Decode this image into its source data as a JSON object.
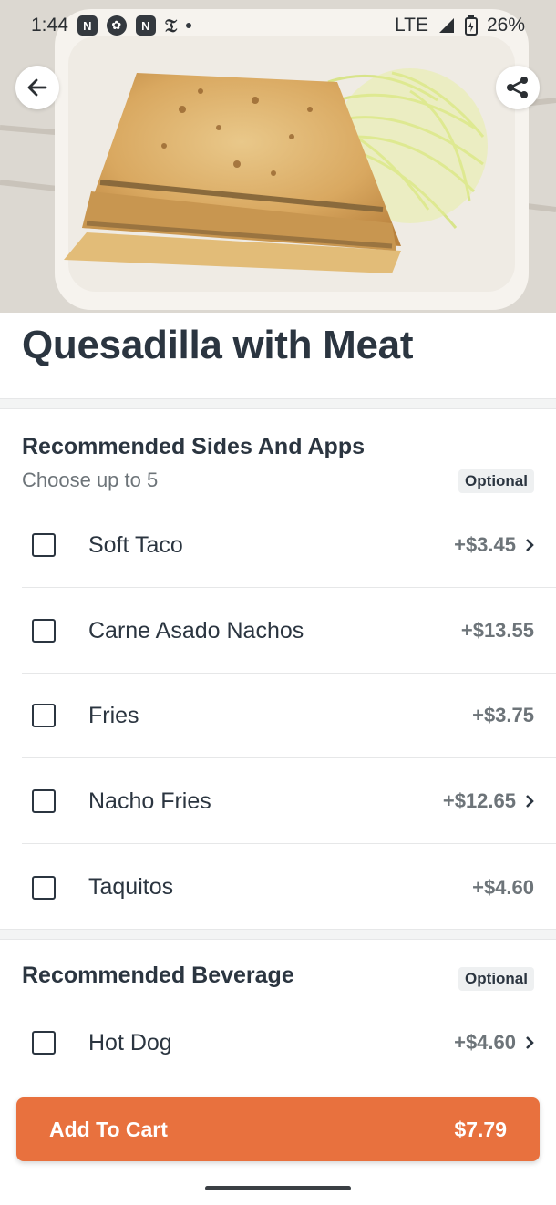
{
  "status_bar": {
    "time": "1:44",
    "network": "LTE",
    "battery": "26%",
    "icons": [
      "news-app-icon",
      "settings-app-icon",
      "news-app-icon",
      "nyt-icon"
    ]
  },
  "item": {
    "title": "Quesadilla with Meat"
  },
  "sections": [
    {
      "title": "Recommended Sides And Apps",
      "subtitle": "Choose up to 5",
      "badge": "Optional",
      "options": [
        {
          "label": "Soft Taco",
          "price": "+$3.45",
          "has_chevron": true
        },
        {
          "label": "Carne Asado Nachos",
          "price": "+$13.55",
          "has_chevron": false
        },
        {
          "label": "Fries",
          "price": "+$3.75",
          "has_chevron": false
        },
        {
          "label": "Nacho Fries",
          "price": "+$12.65",
          "has_chevron": true
        },
        {
          "label": "Taquitos",
          "price": "+$4.60",
          "has_chevron": false
        }
      ]
    },
    {
      "title": "Recommended Beverage",
      "badge": "Optional",
      "options": [
        {
          "label": "Hot Dog",
          "price": "+$4.60",
          "has_chevron": true
        }
      ]
    }
  ],
  "cart": {
    "label": "Add To Cart",
    "price": "$7.79"
  },
  "colors": {
    "accent": "#e8713e",
    "text": "#2b3540",
    "muted": "#6d7479"
  }
}
